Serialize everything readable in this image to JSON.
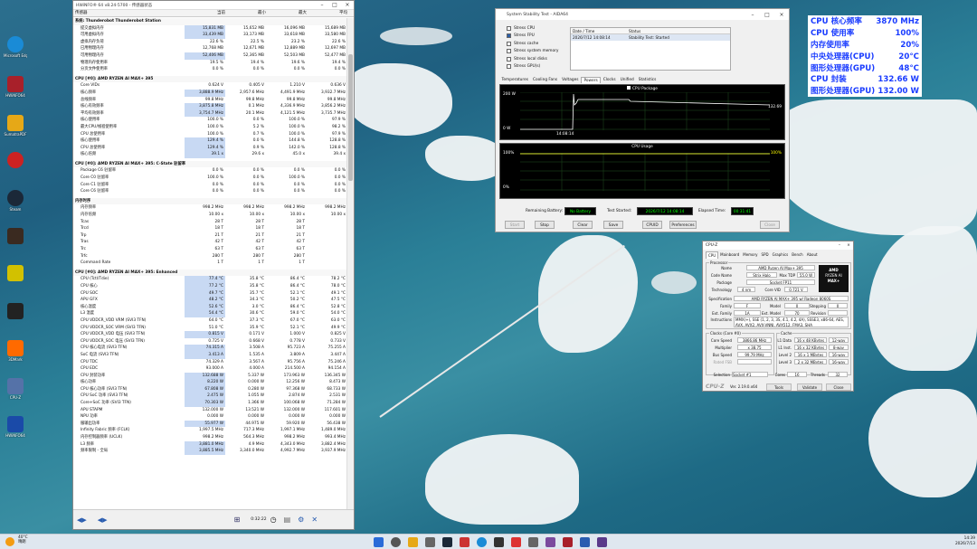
{
  "desktop": {
    "icons": [
      {
        "label": "Microsoft Edge",
        "color": "#1a8bd6"
      },
      {
        "label": "HWiNFO64",
        "color": "#a8202a"
      },
      {
        "label": "SumatraPDF",
        "color": "#e6a817"
      },
      {
        "label": "Steam",
        "color": "#1b2838"
      },
      {
        "label": "Game",
        "color": "#3a2a20"
      },
      {
        "label": "Game 2077",
        "color": "#d2c100"
      },
      {
        "label": "Shadow of the Tomb Raider",
        "color": "#222"
      },
      {
        "label": "3DMark",
        "color": "#ff6a00"
      },
      {
        "label": "CPU-Z",
        "color": "#5572a8"
      },
      {
        "label": "HWiNFO64",
        "color": "#1a4aa8"
      }
    ]
  },
  "hwinfo": {
    "title": "HWiNFO® 64 v8.24-5700 - 传感器状态",
    "headers": [
      "传感器",
      "当前",
      "最小",
      "最大",
      "平均"
    ],
    "rows": [
      {
        "t": "sec",
        "n": "系统: Thunderobot Thunderobot Station"
      },
      {
        "n": "提交虚拟内存",
        "v": [
          "15,831 MB",
          "15,652 MB",
          "16,096 MB",
          "15,689 MB"
        ],
        "hl": true
      },
      {
        "n": "可用虚拟内存",
        "v": [
          "33,439 MB",
          "33,173 MB",
          "33,618 MB",
          "33,580 MB"
        ],
        "hl": true
      },
      {
        "n": "虚拟内存负荷",
        "v": [
          "22.6 %",
          "22.5 %",
          "23.2 %",
          "22.6 %"
        ]
      },
      {
        "n": "已用物理内存",
        "v": [
          "12,768 MB",
          "12,671 MB",
          "12,889 MB",
          "12,697 MB"
        ]
      },
      {
        "n": "可用物理内存",
        "v": [
          "52,406 MB",
          "52,365 MB",
          "52,503 MB",
          "52,477 MB"
        ],
        "hl": true
      },
      {
        "n": "物理内存使用率",
        "v": [
          "19.5 %",
          "19.4 %",
          "19.6 %",
          "19.4 %"
        ]
      },
      {
        "n": "分页文件使用率",
        "v": [
          "0.0 %",
          "0.0 %",
          "0.0 %",
          "0.0 %"
        ]
      },
      {
        "t": "gap"
      },
      {
        "t": "sec",
        "n": "CPU [#0]: AMD RYZEN AI MAX+ 395"
      },
      {
        "n": "Core VIDs",
        "v": [
          "0.624 V",
          "0.405 V",
          "1.210 V",
          "0.636 V"
        ]
      },
      {
        "n": "核心频率",
        "v": [
          "3,888.9 MHz",
          "2,957.6 MHz",
          "4,491.9 MHz",
          "3,932.7 MHz"
        ],
        "hl": true
      },
      {
        "n": "总线频率",
        "v": [
          "99.8 MHz",
          "99.8 MHz",
          "99.8 MHz",
          "99.8 MHz"
        ]
      },
      {
        "n": "核心有效频率",
        "v": [
          "3,875.8 MHz",
          "0.1 MHz",
          "4,336.9 MHz",
          "3,856.2 MHz"
        ],
        "hl": true
      },
      {
        "n": "平均有效频率",
        "v": [
          "3,754.7 MHz",
          "20.1 MHz",
          "4,121.5 MHz",
          "3,735.7 MHz"
        ],
        "hl": true
      },
      {
        "n": "核心使用率",
        "v": [
          "100.0 %",
          "0.0 %",
          "100.0 %",
          "97.9 %"
        ]
      },
      {
        "n": "最大CPU/线程使用率",
        "v": [
          "100.0 %",
          "5.2 %",
          "100.0 %",
          "98.2 %"
        ]
      },
      {
        "n": "CPU 总使用率",
        "v": [
          "100.0 %",
          "0.7 %",
          "100.0 %",
          "97.9 %"
        ]
      },
      {
        "n": "核心使用率",
        "v": [
          "129.4 %",
          "0.0 %",
          "144.8 %",
          "128.8 %"
        ],
        "hl": true
      },
      {
        "n": "CPU 总使用率",
        "v": [
          "129.4 %",
          "0.9 %",
          "142.0 %",
          "128.8 %"
        ],
        "hl": true
      },
      {
        "n": "核心倍频",
        "v": [
          "39.1 x",
          "29.6 x",
          "45.0 x",
          "39.4 x"
        ],
        "hl": true
      },
      {
        "t": "gap"
      },
      {
        "t": "sec",
        "n": "CPU [#0]: AMD RYZEN AI MAX+ 395: C-State 驻留率"
      },
      {
        "n": "Package C6 驻留率",
        "v": [
          "0.0 %",
          "0.0 %",
          "0.0 %",
          "0.0 %"
        ]
      },
      {
        "n": "Core C0 驻留率",
        "v": [
          "100.0 %",
          "0.0 %",
          "100.0 %",
          "0.0 %"
        ]
      },
      {
        "n": "Core C1 驻留率",
        "v": [
          "0.0 %",
          "0.0 %",
          "0.0 %",
          "0.0 %"
        ]
      },
      {
        "n": "Core C6 驻留率",
        "v": [
          "0.0 %",
          "0.0 %",
          "0.0 %",
          "0.0 %"
        ]
      },
      {
        "t": "gap"
      },
      {
        "t": "sec",
        "n": "内存时序"
      },
      {
        "n": "内存频率",
        "v": [
          "998.2 MHz",
          "998.2 MHz",
          "998.2 MHz",
          "998.2 MHz"
        ]
      },
      {
        "n": "内存倍频",
        "v": [
          "10.00 x",
          "10.00 x",
          "10.00 x",
          "10.00 x"
        ]
      },
      {
        "n": "Tcas",
        "v": [
          "28 T",
          "28 T",
          "28 T",
          ""
        ]
      },
      {
        "n": "Trcd",
        "v": [
          "18 T",
          "18 T",
          "18 T",
          ""
        ]
      },
      {
        "n": "Trp",
        "v": [
          "21 T",
          "21 T",
          "21 T",
          ""
        ]
      },
      {
        "n": "Tras",
        "v": [
          "42 T",
          "42 T",
          "42 T",
          ""
        ]
      },
      {
        "n": "Trc",
        "v": [
          "63 T",
          "63 T",
          "63 T",
          ""
        ]
      },
      {
        "n": "Trfc",
        "v": [
          "280 T",
          "280 T",
          "280 T",
          ""
        ]
      },
      {
        "n": "Command Rate",
        "v": [
          "1 T",
          "1 T",
          "1 T",
          ""
        ]
      },
      {
        "t": "gap"
      },
      {
        "t": "sec",
        "n": "CPU [#0]: AMD RYZEN AI MAX+ 395: Enhanced"
      },
      {
        "n": "CPU (Tctl/Tdie)",
        "v": [
          "77.4 °C",
          "35.8 °C",
          "86.4 °C",
          "78.2 °C"
        ],
        "hl": true
      },
      {
        "n": "CPU 核心",
        "v": [
          "77.2 °C",
          "35.8 °C",
          "86.4 °C",
          "78.0 °C"
        ],
        "hl": true
      },
      {
        "n": "CPU SOC",
        "v": [
          "49.7 °C",
          "35.7 °C",
          "52.1 °C",
          "49.1 °C"
        ],
        "hl": true
      },
      {
        "n": "APU GFX",
        "v": [
          "48.2 °C",
          "34.3 °C",
          "50.2 °C",
          "47.5 °C"
        ],
        "hl": true
      },
      {
        "n": "核心温度",
        "v": [
          "52.6 °C",
          "3.0 °C",
          "86.4 °C",
          "52.8 °C"
        ],
        "hl": true
      },
      {
        "n": "L3 温度",
        "v": [
          "54.4 °C",
          "30.6 °C",
          "59.0 °C",
          "54.0 °C"
        ],
        "hl": true
      },
      {
        "n": "CPU VDDCR_VDD VRM (SVI3 TFN)",
        "v": [
          "64.0 °C",
          "37.3 °C",
          "67.0 °C",
          "63.0 °C"
        ]
      },
      {
        "n": "CPU VDDCR_SOC VRM (SVI3 TFN)",
        "v": [
          "51.0 °C",
          "35.9 °C",
          "52.1 °C",
          "49.9 °C"
        ]
      },
      {
        "n": "CPU VDDCR_VDD 电压 (SVI3 TFN)",
        "v": [
          "0.815 V",
          "0.171 V",
          "1.000 V",
          "0.825 V"
        ],
        "hl": true
      },
      {
        "n": "CPU VDDCR_SOC 电压 (SVI3 TFN)",
        "v": [
          "0.725 V",
          "0.668 V",
          "0.778 V",
          "0.733 V"
        ]
      },
      {
        "n": "CPU 核心电流 (SVI3 TFN)",
        "v": [
          "74.315 A",
          "3.508 A",
          "95.723 A",
          "75.255 A"
        ],
        "hl": true
      },
      {
        "n": "SoC 电流 (SVI3 TFN)",
        "v": [
          "3.413 A",
          "1.535 A",
          "3.809 A",
          "3.447 A"
        ],
        "hl": true
      },
      {
        "n": "CPU TDC",
        "v": [
          "74.329 A",
          "3.567 A",
          "95.756 A",
          "75.246 A"
        ]
      },
      {
        "n": "CPU EDC",
        "v": [
          "93.000 A",
          "4.000 A",
          "214.500 A",
          "94.154 A"
        ]
      },
      {
        "n": "CPU 封装功率",
        "v": [
          "132.688 W",
          "5.337 W",
          "173.963 W",
          "136.345 W"
        ],
        "hl": true
      },
      {
        "n": "核心功率",
        "v": [
          "8.220 W",
          "0.000 W",
          "12.256 W",
          "8.473 W"
        ],
        "hl": true
      },
      {
        "n": "CPU 核心功率 (SVI3 TFN)",
        "v": [
          "67.808 W",
          "0.280 W",
          "97.368 W",
          "68.733 W"
        ],
        "hl": true
      },
      {
        "n": "CPU SoC 功率 (SVI3 TFN)",
        "v": [
          "2.475 W",
          "1.055 W",
          "2.874 W",
          "2.531 W"
        ],
        "hl": true
      },
      {
        "n": "Core+SoC 功率 (SVI3 TFN)",
        "v": [
          "70.303 W",
          "1.366 W",
          "100.068 W",
          "71.284 W"
        ],
        "hl": true
      },
      {
        "n": "APU STAPM",
        "v": [
          "132.000 W",
          "13.521 W",
          "132.000 W",
          "117.601 W"
        ]
      },
      {
        "n": "NPU 功率",
        "v": [
          "0.000 W",
          "0.000 W",
          "0.000 W",
          "0.000 W"
        ]
      },
      {
        "n": "服输出功率",
        "v": [
          "55.977 W",
          "44.975 W",
          "59.920 W",
          "56.438 W"
        ],
        "hl": true
      },
      {
        "n": "Infinity Fabric 频率 (FCLK)",
        "v": [
          "1,997.5 MHz",
          "717.3 MHz",
          "1,997.1 MHz",
          "1,489.0 MHz"
        ]
      },
      {
        "n": "内存控制器频率 (UCLK)",
        "v": [
          "998.2 MHz",
          "564.3 MHz",
          "998.2 MHz",
          "993.4 MHz"
        ]
      },
      {
        "n": "L3 频率",
        "v": [
          "3,881.0 MHz",
          "4.9 MHz",
          "4,343.0 MHz",
          "3,882.4 MHz"
        ],
        "hl": true
      },
      {
        "n": "频率限制 - 全局",
        "v": [
          "3,885.5 MHz",
          "3,340.0 MHz",
          "4,992.7 MHz",
          "3,937.9 MHz"
        ],
        "hl": true
      }
    ],
    "footer": {
      "time": "0:32:22"
    }
  },
  "aida": {
    "title": "System Stability Test - AIDA64",
    "checks": [
      {
        "label": "Stress CPU",
        "on": false
      },
      {
        "label": "Stress FPU",
        "on": true
      },
      {
        "label": "Stress cache",
        "on": false
      },
      {
        "label": "Stress system memory",
        "on": false
      },
      {
        "label": "Stress local disks",
        "on": false
      },
      {
        "label": "Stress GPU(s)",
        "on": false
      }
    ],
    "table": {
      "h1": "Date / Time",
      "h2": "Status",
      "r1": "2026/7/12 14:08:14",
      "r2": "Stability Test: Started"
    },
    "tabs": [
      "Temperatures",
      "Cooling Fans",
      "Voltages",
      "Powers",
      "Clocks",
      "Unified",
      "Statistics"
    ],
    "active_tab": "Powers",
    "g1": {
      "title": "CPU Package",
      "ymax": "200 W",
      "ymin": "0 W",
      "val": "132.69",
      "time": "14:08:14"
    },
    "g2": {
      "title": "CPU Usage",
      "ymax": "100%",
      "ymin": "0%",
      "val": "100%"
    },
    "status": {
      "battery_label": "Remaining Battery:",
      "battery": "No Battery",
      "started_label": "Test Started:",
      "started": "2026/7/12 14:08:14",
      "elapsed_label": "Elapsed Time:",
      "elapsed": "00:31:41"
    },
    "buttons": [
      "Start",
      "Stop",
      "Clear",
      "Save",
      "CPUID",
      "Preferences",
      "Close"
    ]
  },
  "osd": [
    {
      "k": "CPU 核心频率",
      "v": "3870 MHz"
    },
    {
      "k": "CPU 使用率",
      "v": "100%"
    },
    {
      "k": "内存使用率",
      "v": "20%"
    },
    {
      "k": "中央处理器(CPU)",
      "v": "20°C"
    },
    {
      "k": "图形处理器(GPU)",
      "v": "48°C"
    },
    {
      "k": "CPU 封装",
      "v": "132.66 W"
    },
    {
      "k": "图形处理器(GPU)",
      "v": "132.00 W"
    }
  ],
  "cpuz": {
    "title": "CPU-Z",
    "tabs": [
      "CPU",
      "Mainboard",
      "Memory",
      "SPD",
      "Graphics",
      "Bench",
      "About"
    ],
    "proc": {
      "name": "AMD Ryzen AI Max+ 395",
      "code": "Strix Halo",
      "maxtdp": "55.0 W",
      "package": "Socket FP11",
      "tech": "4 nm",
      "vcore": "0.721 V",
      "spec": "AMD RYZEN AI MAX+ 395 w/ Radeon 8060S",
      "family": "F",
      "model": "0",
      "stepping": "0",
      "extfam": "1A",
      "extmodel": "70",
      "revision": "",
      "instr": "MMX(+), SSE (1, 2, 3, 3S, 4.1, 4.2, 4A), SSSE3, x86-64, AES, AVX, AVX2, AVX-VNNI, AVX512, FMA3, SHA"
    },
    "clocks": {
      "speed": "3866.86 MHz",
      "mult": "x 38.75",
      "bus": "99.79 MHz",
      "fsb": ""
    },
    "cache": {
      "l1d": "16 x 48 KBytes",
      "l1dw": "12-way",
      "l1i": "16 x 32 KBytes",
      "l1iw": "8-way",
      "l2": "16 x 1 MBytes",
      "l2w": "16-way",
      "l3": "2 x 32 MBytes",
      "l3w": "16-way"
    },
    "sel": {
      "socket": "Socket #1",
      "cores": "16",
      "threads": "32"
    },
    "footer": {
      "ver": "Ver. 2.19.0.x64",
      "tools": "Tools",
      "validate": "Validate",
      "close": "Close"
    },
    "logo": {
      "l1": "AMD",
      "l2": "RYZEN AI",
      "l3": "MAX+"
    },
    "labels": {
      "name": "Name",
      "code": "Code Name",
      "maxtdp": "Max TDP",
      "package": "Package",
      "tech": "Technology",
      "vcore": "Core VID",
      "spec": "Specification",
      "family": "Family",
      "model": "Model",
      "stepping": "Stepping",
      "extfam": "Ext. Family",
      "extmodel": "Ext. Model",
      "revision": "Revision",
      "instr": "Instructions",
      "speed": "Core Speed",
      "mult": "Multiplier",
      "bus": "Bus Speed",
      "fsb": "Rated FSB",
      "l1d": "L1 Data",
      "l1i": "L1 Inst.",
      "l2": "Level 2",
      "l3": "Level 3",
      "selection": "Selection",
      "cores": "Cores",
      "threads": "Threads",
      "processor": "Processor",
      "clocksg": "Clocks (Core #0)",
      "cacheg": "Cache"
    }
  },
  "taskbar": {
    "weather": "40°C",
    "weather2": "晴朗",
    "time": "14:39",
    "date": "2026/7/13"
  }
}
